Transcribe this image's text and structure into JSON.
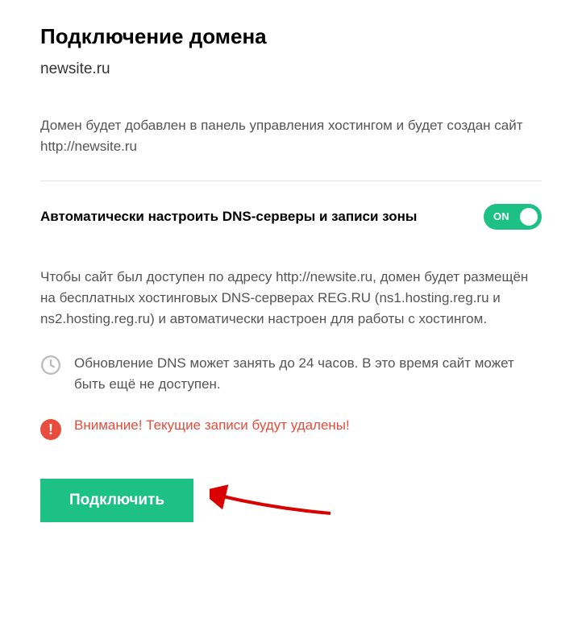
{
  "title": "Подключение домена",
  "domain": "newsite.ru",
  "description": "Домен будет добавлен в панель управления хостингом и будет создан сайт http://newsite.ru",
  "toggle": {
    "label": "Автоматически настроить DNS-серверы и записи зоны",
    "state_text": "ON"
  },
  "info": "Чтобы сайт был доступен по адресу http://newsite.ru, домен будет размещён на бесплатных хостинговых DNS-серверах REG.RU (ns1.hosting.reg.ru и ns2.hosting.reg.ru) и автоматически настроен для работы с хостингом.",
  "time_notice": "Обновление DNS может занять до 24 часов. В это время сайт может быть ещё не доступен.",
  "warning": "Внимание! Текущие записи будут удалены!",
  "submit_label": "Подключить"
}
